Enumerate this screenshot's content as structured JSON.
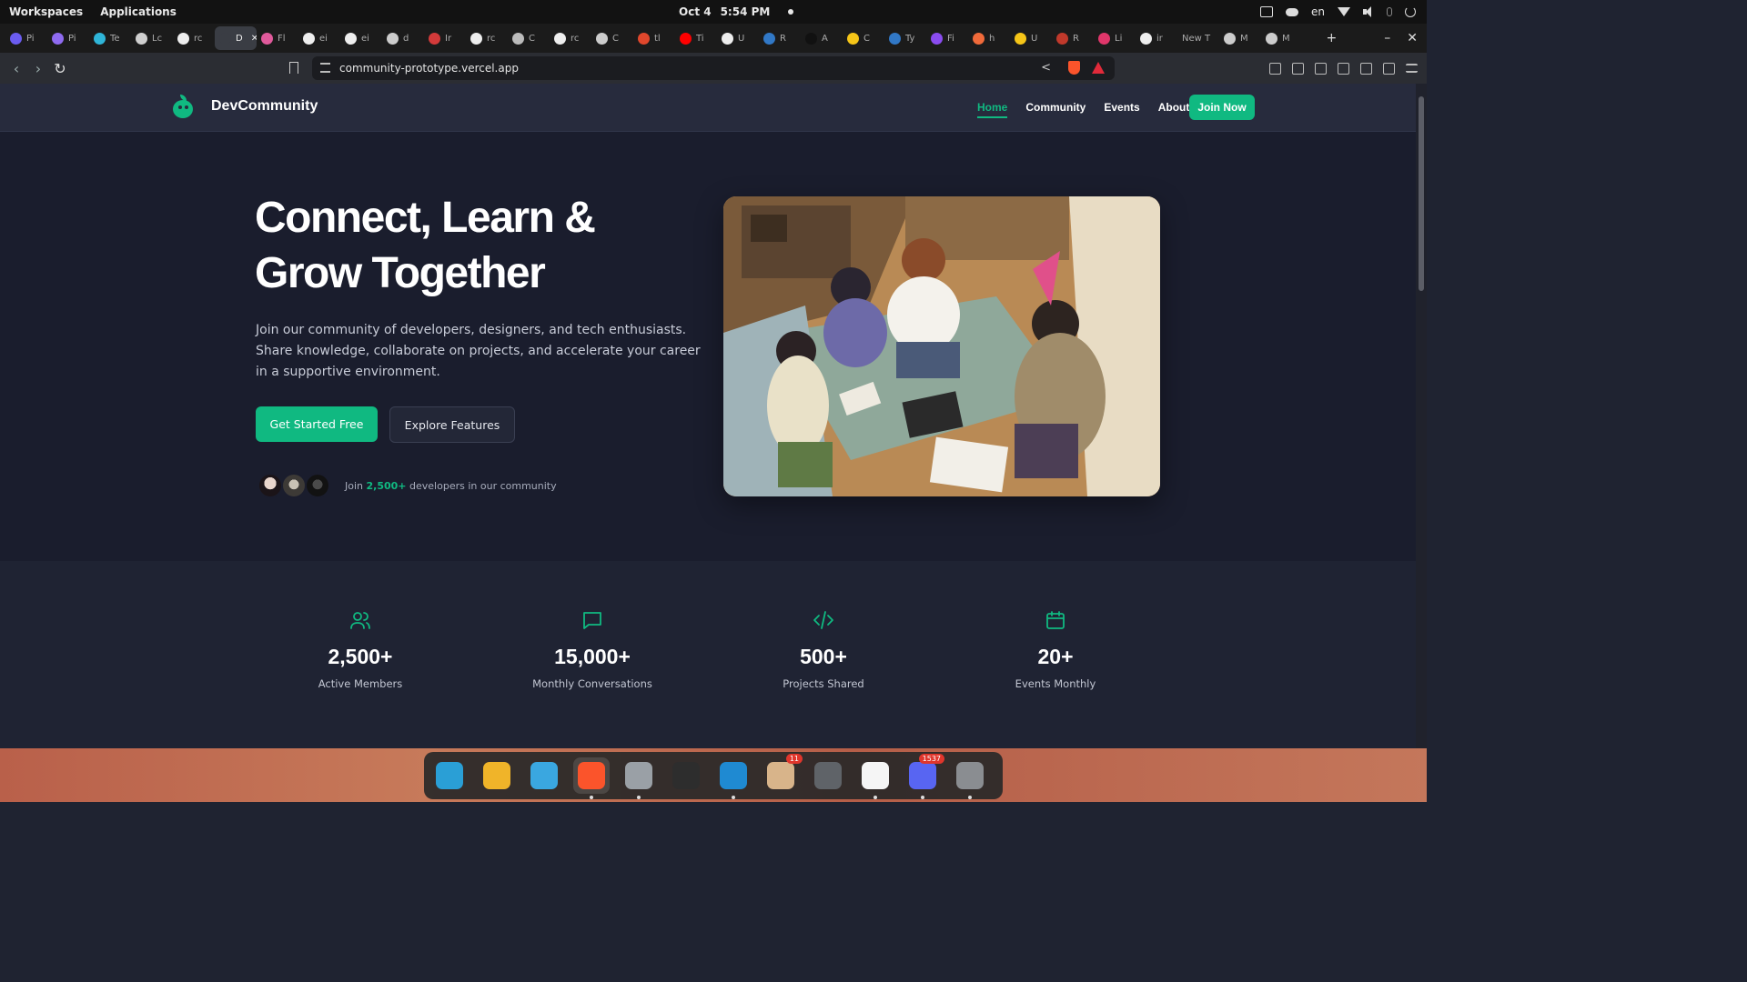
{
  "os": {
    "workspaces": "Workspaces",
    "applications": "Applications",
    "date": "Oct 4",
    "time": "5:54 PM",
    "lang": "en"
  },
  "browser": {
    "tabs": [
      {
        "label": "Pi",
        "color": "#6b5cf0"
      },
      {
        "label": "Pi",
        "color": "#8f6bf0"
      },
      {
        "label": "Te",
        "color": "#2fb5d8"
      },
      {
        "label": "Lc",
        "color": "#cfcfcf"
      },
      {
        "label": "rc",
        "color": "#eeeeee"
      },
      {
        "label": "D",
        "color": "#3a3d44",
        "active": true
      },
      {
        "label": "Fl",
        "color": "#e05a9b"
      },
      {
        "label": "ei",
        "color": "#eeeeee"
      },
      {
        "label": "ei",
        "color": "#eeeeee"
      },
      {
        "label": "d",
        "color": "#cccccc"
      },
      {
        "label": "Ir",
        "color": "#d33a3a"
      },
      {
        "label": "rc",
        "color": "#eeeeee"
      },
      {
        "label": "C",
        "color": "#bbbbbb"
      },
      {
        "label": "rc",
        "color": "#eeeeee"
      },
      {
        "label": "C",
        "color": "#cccccc"
      },
      {
        "label": "tl",
        "color": "#e0472c"
      },
      {
        "label": "Ti",
        "color": "#ff0000"
      },
      {
        "label": "U",
        "color": "#eeeeee"
      },
      {
        "label": "R",
        "color": "#3178c6"
      },
      {
        "label": "A",
        "color": "#111111"
      },
      {
        "label": "C",
        "color": "#f5c518"
      },
      {
        "label": "Ty",
        "color": "#3178c6"
      },
      {
        "label": "Fi",
        "color": "#8a4cf0"
      },
      {
        "label": "h",
        "color": "#f06a3a"
      },
      {
        "label": "U",
        "color": "#f5c518"
      },
      {
        "label": "R",
        "color": "#c0392b"
      },
      {
        "label": "Li",
        "color": "#e0366a"
      },
      {
        "label": "ir",
        "color": "#eeeeee"
      },
      {
        "label": "New T",
        "color": "transparent"
      },
      {
        "label": "M",
        "color": "#cccccc"
      },
      {
        "label": "M",
        "color": "#cccccc"
      }
    ],
    "url": "community-prototype.vercel.app"
  },
  "site": {
    "brand": "DevCommunity",
    "nav": {
      "home": "Home",
      "community": "Community",
      "events": "Events",
      "about": "About",
      "join": "Join Now"
    },
    "hero": {
      "title_line1": "Connect, Learn &",
      "title_line2": "Grow Together",
      "subtitle": "Join our community of developers, designers, and tech enthusiasts. Share knowledge, collaborate on projects, and accelerate your career in a supportive environment.",
      "cta_primary": "Get Started Free",
      "cta_secondary": "Explore Features",
      "community_prefix": "Join",
      "community_count": "2,500+",
      "community_suffix": "developers in our community"
    },
    "stats": [
      {
        "icon": "users-icon",
        "value": "2,500+",
        "label": "Active Members"
      },
      {
        "icon": "chat-icon",
        "value": "15,000+",
        "label": "Monthly Conversations"
      },
      {
        "icon": "code-icon",
        "value": "500+",
        "label": "Projects Shared"
      },
      {
        "icon": "calendar-icon",
        "value": "20+",
        "label": "Events Monthly"
      }
    ],
    "accent_color": "#10b981"
  },
  "dock": {
    "items": [
      {
        "name": "search-app-icon"
      },
      {
        "name": "files-preview-icon"
      },
      {
        "name": "app-grid-icon"
      },
      {
        "name": "brave-browser-icon",
        "active": true
      },
      {
        "name": "file-manager-icon"
      },
      {
        "name": "terminal-icon"
      },
      {
        "name": "vscode-icon"
      },
      {
        "name": "update-manager-icon",
        "badge": "11"
      },
      {
        "name": "settings-icon"
      },
      {
        "name": "wave-app-icon"
      },
      {
        "name": "discord-icon",
        "badge": "1537"
      },
      {
        "name": "disk-utility-icon"
      }
    ]
  }
}
